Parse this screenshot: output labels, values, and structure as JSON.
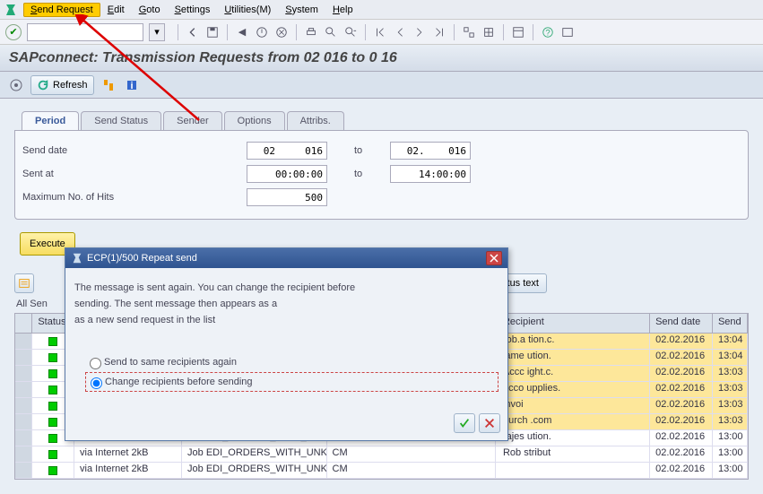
{
  "menu": {
    "items": [
      "Send Request",
      "Edit",
      "Goto",
      "Settings",
      "Utilities(M)",
      "System",
      "Help"
    ],
    "highlighted_index": 0
  },
  "title": "SAPconnect: Transmission Requests from 02    016 to 0      16",
  "subtoolbar": {
    "refresh": "Refresh"
  },
  "tabs": {
    "items": [
      "Period",
      "Send Status",
      "Sender",
      "Options",
      "Attribs."
    ],
    "active": 0
  },
  "filters": {
    "send_date": {
      "label": "Send date",
      "from": "02     016",
      "to_label": "to",
      "to": "02.    016"
    },
    "sent_at": {
      "label": "Sent at",
      "from": "00:00:00",
      "to_label": "to",
      "to": "14:00:00"
    },
    "max_hits": {
      "label": "Maximum No. of Hits",
      "value": "500"
    }
  },
  "execute_label": "Execute",
  "grid_toolbar": {
    "status_text": "Status text"
  },
  "filter_summary": "All Sen",
  "grid": {
    "headers": {
      "status": "Status",
      "msg": "",
      "title": "",
      "sender": "",
      "recipient": "Recipient",
      "send_date": "Send date",
      "send_time": "Send"
    },
    "rows": [
      {
        "hl": true,
        "status": "green",
        "msg": "",
        "title": "",
        "sender": "",
        "recipient": "rob.a                    tion.c.",
        "send_date": "02.02.2016",
        "send_time": "13:04"
      },
      {
        "hl": true,
        "status": "green",
        "msg": "",
        "title": "",
        "sender": "",
        "recipient": "jame                      ution.",
        "send_date": "02.02.2016",
        "send_time": "13:04"
      },
      {
        "hl": true,
        "status": "green",
        "msg": "",
        "title": "",
        "sender": "",
        "recipient": "Accc                      ight.c.",
        "send_date": "02.02.2016",
        "send_time": "13:03"
      },
      {
        "hl": true,
        "status": "green",
        "msg": "",
        "title": "",
        "sender": "",
        "recipient": "acco                     upplies.",
        "send_date": "02.02.2016",
        "send_time": "13:03"
      },
      {
        "hl": true,
        "status": "green",
        "msg": "",
        "title": "",
        "sender": "",
        "recipient": "invoi                          ",
        "send_date": "02.02.2016",
        "send_time": "13:03"
      },
      {
        "hl": true,
        "status": "green",
        "msg": "",
        "title": "",
        "sender": "",
        "recipient": "purch                      .com",
        "send_date": "02.02.2016",
        "send_time": "13:03"
      },
      {
        "hl": false,
        "status": "green",
        "msg": "via Internet  2kB",
        "title": "Job EDI_ORDERS_WITH_UNKNOWN",
        "sender": "CM",
        "recipient": "rajes                       ution.",
        "send_date": "02.02.2016",
        "send_time": "13:00"
      },
      {
        "hl": false,
        "status": "green",
        "msg": "via Internet  2kB",
        "title": "Job EDI_ORDERS_WITH_UNKNOWN",
        "sender": "CM",
        "recipient": "Rob                        stribut",
        "send_date": "02.02.2016",
        "send_time": "13:00"
      },
      {
        "hl": false,
        "status": "green",
        "msg": "via Internet  2kB",
        "title": "Job EDI_ORDERS_WITH_UNKNOWN",
        "sender": "CM",
        "recipient": "",
        "send_date": "02.02.2016",
        "send_time": "13:00"
      }
    ]
  },
  "modal": {
    "title": "ECP(1)/500 Repeat send",
    "line1": "The message is sent again. You can change the recipient before",
    "line2": "sending. The sent message then appears as a",
    "line3": "as a new send request in the list",
    "radio1": "Send to same recipients again",
    "radio2": "Change recipients before sending",
    "selected": 1
  }
}
